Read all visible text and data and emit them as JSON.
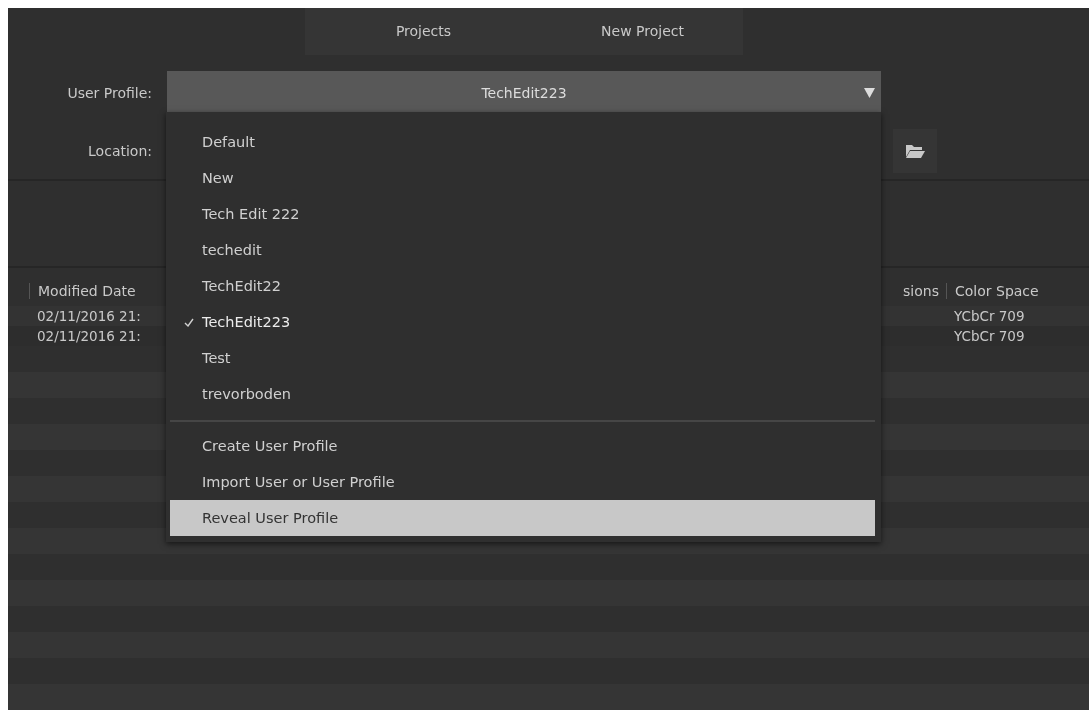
{
  "tabs": [
    {
      "label": "Projects",
      "selected": false
    },
    {
      "label": "New Project",
      "selected": false
    }
  ],
  "user_profile": {
    "label": "User Profile:",
    "value": "TechEdit223",
    "expanded": true
  },
  "location": {
    "label": "Location:"
  },
  "profile_menu": {
    "profiles": [
      {
        "label": "Default",
        "selected": false
      },
      {
        "label": "New",
        "selected": false
      },
      {
        "label": "Tech Edit 222",
        "selected": false
      },
      {
        "label": "techedit",
        "selected": false
      },
      {
        "label": "TechEdit22",
        "selected": false
      },
      {
        "label": "TechEdit223",
        "selected": true
      },
      {
        "label": "Test",
        "selected": false
      },
      {
        "label": "trevorboden",
        "selected": false
      }
    ],
    "actions": [
      {
        "label": "Create User Profile",
        "highlighted": false
      },
      {
        "label": "Import User or User Profile",
        "highlighted": false
      },
      {
        "label": "Reveal User Profile",
        "highlighted": true
      }
    ]
  },
  "table": {
    "columns": [
      "Modified Date",
      "sions",
      "Color Space"
    ],
    "rows": [
      {
        "modified_date": "02/11/2016 21:",
        "color_space": "YCbCr 709"
      },
      {
        "modified_date": "02/11/2016 21:",
        "color_space": "YCbCr 709"
      }
    ]
  }
}
